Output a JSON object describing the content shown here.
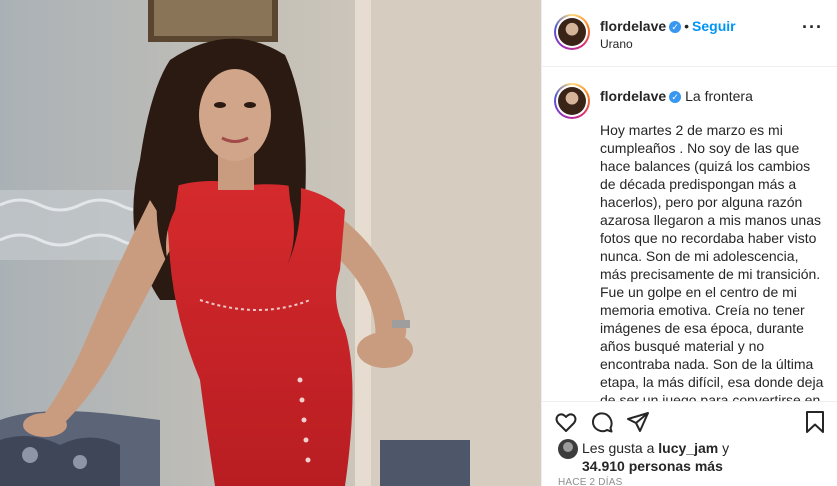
{
  "header": {
    "username": "flordelave",
    "follow_label": "Seguir",
    "separator": "•",
    "location": "Urano",
    "more_label": "···"
  },
  "caption": {
    "username": "flordelave",
    "title": "La frontera",
    "text": "Hoy martes 2 de marzo es mi cumpleaños . No soy de las que hace balances (quizá los cambios de década predispongan más a hacerlos), pero por alguna razón azarosa llegaron a mis manos unas fotos que no recordaba haber visto nunca. Son de mi adolescencia, más precisamente de mi transición. Fue un golpe en el centro de mi memoria emotiva. Creía no tener imágenes de esa época, durante años busqué material y no encontraba nada. Son de la última etapa, la más difícil, esa donde deja de ser un juego para convertirse en una realidad: la del miedo, la incertidumbre, la de las"
  },
  "likes": {
    "prefix": "Les gusta a",
    "user": "lucy_jam",
    "connector": "y",
    "count_text": "34.910 personas más"
  },
  "timestamp": "HACE 2 DÍAS",
  "icons": {
    "like": "heart-icon",
    "comment": "comment-icon",
    "share": "share-icon",
    "save": "bookmark-icon",
    "verified": "verified-badge-icon"
  },
  "colors": {
    "accent": "#0095f6",
    "verified": "#3897f0",
    "text": "#262626",
    "muted": "#8e8e8e",
    "dress": "#d8262a"
  }
}
